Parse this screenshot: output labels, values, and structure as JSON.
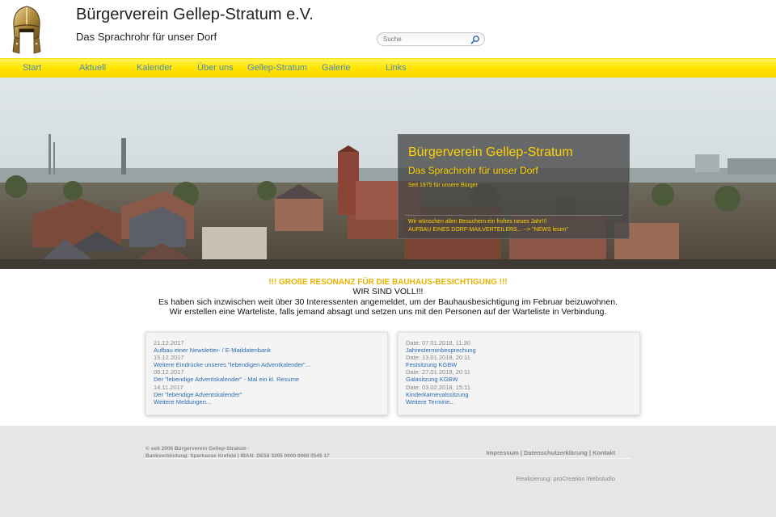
{
  "header": {
    "title": "Bürgerverein Gellep-Stratum e.V.",
    "subtitle": "Das Sprachrohr für unser Dorf",
    "search_placeholder": "Suche"
  },
  "nav": {
    "items": [
      {
        "label": "Start"
      },
      {
        "label": "Aktuell"
      },
      {
        "label": "Kalender"
      },
      {
        "label": "Über uns"
      },
      {
        "label": "Gellep-Stratum"
      },
      {
        "label": "Galerie"
      },
      {
        "label": "Links"
      }
    ],
    "link_color": "#4a8bc4",
    "bar_color": "#ffe600"
  },
  "hero": {
    "title": "Bürgerverein Gellep-Stratum",
    "subtitle": "Das Sprachrohr für unser Dorf",
    "since": "Seit 1975 für unsere Bürger",
    "greeting": "Wir wünschen allen Besuchern ein frohes neues Jahr!!!",
    "news": "AUFBAU EINES DORF-MAILVERTEILERS... --> \"NEWS lesen\"",
    "accent_color": "#ffd300"
  },
  "notice": {
    "heading": "!!! GROßE RESONANZ FÜR DIE BAUHAUS-BESICHTIGUNG !!!",
    "lines": [
      "WIR SIND VOLL!!!",
      "Es haben sich inzwischen weit über 30 Interessenten angemeldet, um der Bauhausbesichtigung im Februar beizuwohnen.",
      "Wir erstellen eine Warteliste, falls jemand absagt und setzen uns mit den Personen auf der Warteliste in Verbindung."
    ]
  },
  "news_panel": {
    "entries": [
      {
        "date": "21.12.2017",
        "title": "Aufbau einer Newsletter- / E-Maildatenbank"
      },
      {
        "date": "15.12.2017",
        "title": "Weitere Eindrücke unseres \"lebendigen Adventkalender\"..."
      },
      {
        "date": "06.12.2017",
        "title": "Der \"lebendige Adventskalender\" - Mal ein kl. Resume"
      },
      {
        "date": "14.11.2017",
        "title": "Der \"lebendige Adventskalender\""
      }
    ],
    "more": "Weitere Meldungen..."
  },
  "events_panel": {
    "entries": [
      {
        "date": "Date: 07.01.2018, 11:30",
        "title": "Jahresterminbesprechung"
      },
      {
        "date": "Date: 13.01.2018, 20:11",
        "title": "Festsitzung KGBW"
      },
      {
        "date": "Date: 27.01.2018, 20:11",
        "title": "Galasitzung KGBW"
      },
      {
        "date": "Date: 03.02.2018, 15:11",
        "title": "Kinderkarnevalssitzung"
      }
    ],
    "more": "Weitere Termine..."
  },
  "footer": {
    "copyright": "© seit 2006 Bürgerverein Gellep-Stratum ·",
    "bank": "Bankverbindung: Sparkasse Krefeld | IBAN: DE58 3205 0000 0060 0545 17",
    "links": [
      "Impressum",
      "Datenschutzerklärung",
      "Kontakt"
    ],
    "separator": "|",
    "credit": "Realisierung: proCreation Webstudio"
  }
}
